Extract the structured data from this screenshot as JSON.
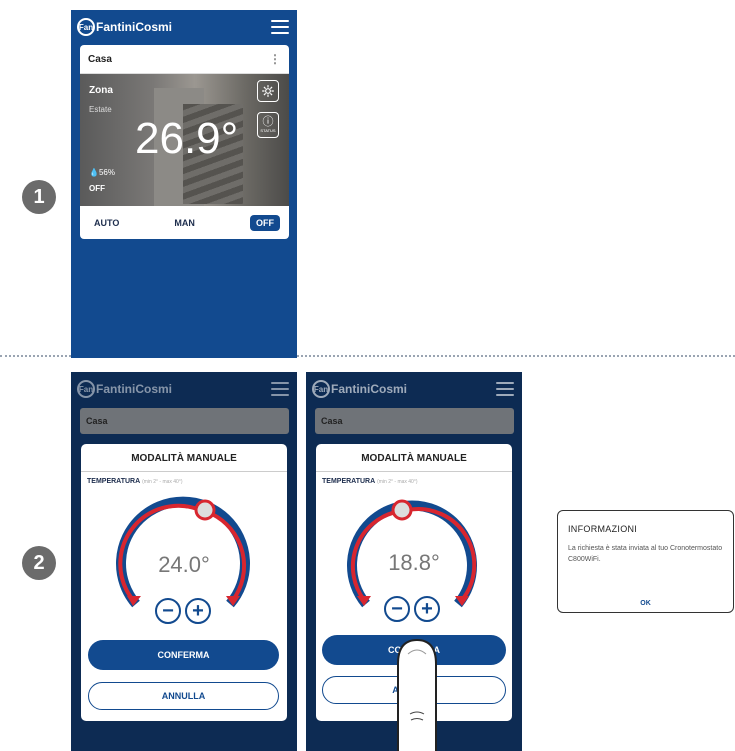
{
  "steps": [
    "1",
    "2"
  ],
  "brand": "FantiniCosmi",
  "brand_ring": "Fan",
  "home": {
    "location": "Casa",
    "zone": "Zona",
    "season": "Estate",
    "temperature": "26.9°",
    "humidity": "💧56%",
    "status": "OFF",
    "status_button": "STATUS",
    "modes": {
      "auto": "AUTO",
      "man": "MAN",
      "off": "OFF"
    }
  },
  "manual_left": {
    "title": "MODALITÀ MANUALE",
    "temp_label": "TEMPERATURA",
    "temp_hint": "(min 2° - max 40°)",
    "value": "24.0°",
    "confirm": "CONFERMA",
    "cancel": "ANNULLA"
  },
  "manual_right": {
    "title": "MODALITÀ MANUALE",
    "temp_label": "TEMPERATURA",
    "temp_hint": "(min 2° - max 40°)",
    "value": "18.8°",
    "confirm": "CONFERMA",
    "cancel": "ANNULLA"
  },
  "info": {
    "title": "INFORMAZIONI",
    "body": "La richiesta è stata inviata al tuo Cronotermostato C800WiFi.",
    "ok": "OK"
  },
  "colors": {
    "brand_blue": "#124a8f",
    "dial_red": "#d8262f",
    "badge_gray": "#6b6b6b"
  }
}
